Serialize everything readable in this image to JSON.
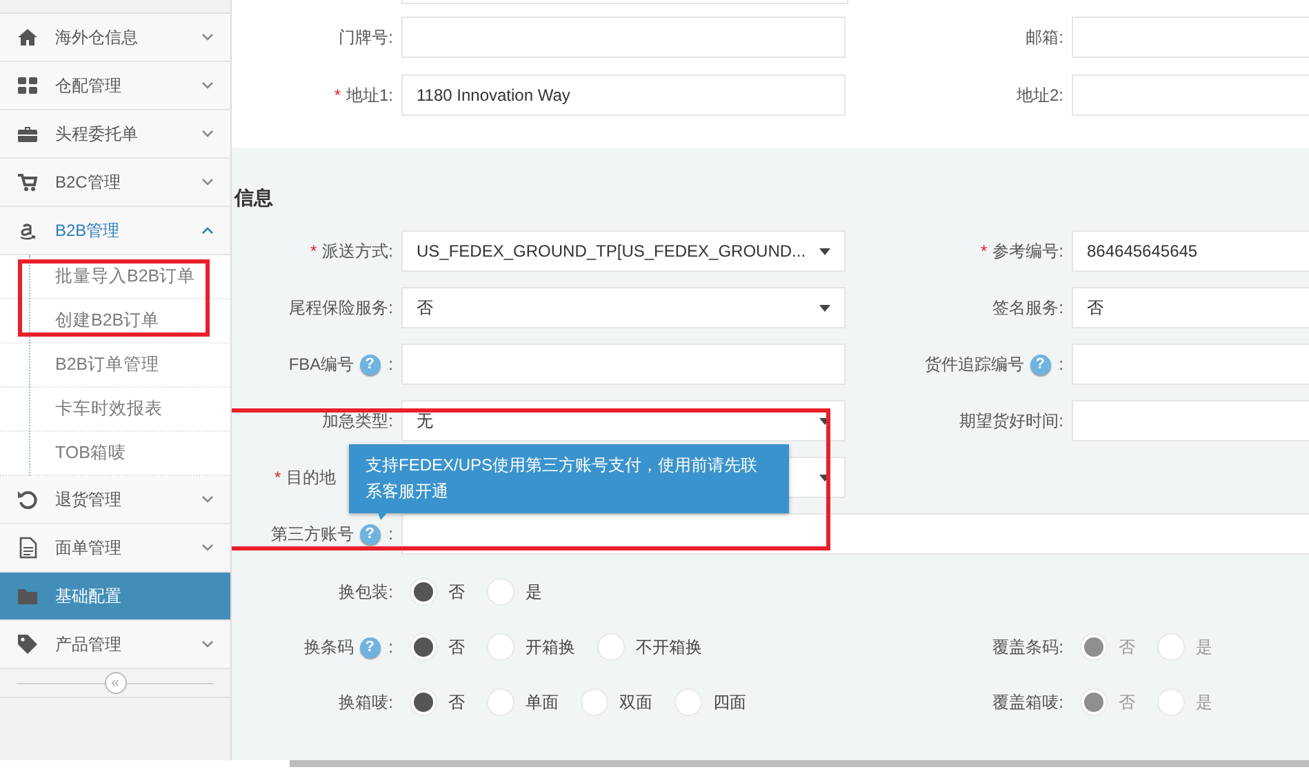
{
  "sidebar": {
    "items": [
      {
        "label": "海外仓信息",
        "kind": "group",
        "expanded": false,
        "selected": false
      },
      {
        "label": "仓配管理",
        "kind": "group",
        "expanded": false,
        "selected": false
      },
      {
        "label": "头程委托单",
        "kind": "group",
        "expanded": false,
        "selected": false
      },
      {
        "label": "B2C管理",
        "kind": "group",
        "expanded": false,
        "selected": false
      },
      {
        "label": "B2B管理",
        "kind": "group",
        "expanded": true,
        "selected": false,
        "children": [
          {
            "label": "批量导入B2B订单",
            "highlighted": true
          },
          {
            "label": "创建B2B订单",
            "highlighted": true
          },
          {
            "label": "B2B订单管理",
            "highlighted": false
          },
          {
            "label": "卡车时效报表",
            "highlighted": false
          },
          {
            "label": "TOB箱唛",
            "highlighted": false
          }
        ]
      },
      {
        "label": "退货管理",
        "kind": "group",
        "expanded": false,
        "selected": false
      },
      {
        "label": "面单管理",
        "kind": "group",
        "expanded": false,
        "selected": false
      },
      {
        "label": "基础配置",
        "kind": "link",
        "selected": true
      },
      {
        "label": "产品管理",
        "kind": "group",
        "expanded": false,
        "selected": false
      }
    ],
    "collapse_label": "«"
  },
  "address_rows": [
    {
      "left": {
        "label": "门牌号:"
      },
      "right": {
        "label": "邮箱:"
      }
    },
    {
      "left": {
        "label": "地址1:",
        "mark": "*",
        "value": "1180 Innovation Way"
      },
      "right": {
        "label": "地址2:"
      }
    }
  ],
  "section_title": "信息",
  "form_rows": [
    {
      "left": {
        "label": "派送方式:",
        "mark": "*",
        "kind": "select",
        "value": "US_FEDEX_GROUND_TP[US_FEDEX_GROUND..."
      },
      "right": {
        "label": "参考编号:",
        "mark": "*",
        "value": "864645645645"
      }
    },
    {
      "left": {
        "label": "尾程保险服务:",
        "kind": "select",
        "value": "否"
      },
      "right": {
        "label": "签名服务:",
        "value": "否"
      }
    },
    {
      "left": {
        "label": "FBA编号",
        "help": "?",
        "tail": ":",
        "kind": "input"
      },
      "right": {
        "label": "货件追踪编号",
        "help": "?",
        "tail": ":"
      }
    },
    {
      "left": {
        "label": "加急类型:",
        "kind": "select",
        "value": "无"
      },
      "right": {
        "label": "期望货好时间:"
      }
    },
    {
      "left": {
        "label": "目的地",
        "mark": "*",
        "covered": true,
        "kind": "select"
      }
    },
    {
      "left": {
        "label": "第三方账号",
        "help": "?",
        "tail": ":",
        "kind": "wide"
      }
    }
  ],
  "tooltip": "支持FEDEX/UPS使用第三方账号支付，使用前请先联系客服开通",
  "radio_rows": [
    {
      "left": {
        "label": "换包装:",
        "disabled": false,
        "options": [
          {
            "label": "否",
            "selected": true
          },
          {
            "label": "是",
            "selected": false
          }
        ]
      }
    },
    {
      "left": {
        "label": "换条码",
        "help": "?",
        "tail": ":",
        "disabled": false,
        "options": [
          {
            "label": "否",
            "selected": true
          },
          {
            "label": "开箱换",
            "selected": false
          },
          {
            "label": "不开箱换",
            "selected": false
          }
        ]
      },
      "right": {
        "label": "覆盖条码:",
        "disabled": true,
        "options": [
          {
            "label": "否",
            "selected": true
          },
          {
            "label": "是",
            "selected": false
          }
        ]
      }
    },
    {
      "left": {
        "label": "换箱唛:",
        "disabled": false,
        "options": [
          {
            "label": "否",
            "selected": true
          },
          {
            "label": "单面",
            "selected": false
          },
          {
            "label": "双面",
            "selected": false
          },
          {
            "label": "四面",
            "selected": false
          }
        ]
      },
      "right": {
        "label": "覆盖箱唛:",
        "disabled": true,
        "options": [
          {
            "label": "否",
            "selected": true
          },
          {
            "label": "是",
            "selected": false
          }
        ]
      }
    }
  ]
}
